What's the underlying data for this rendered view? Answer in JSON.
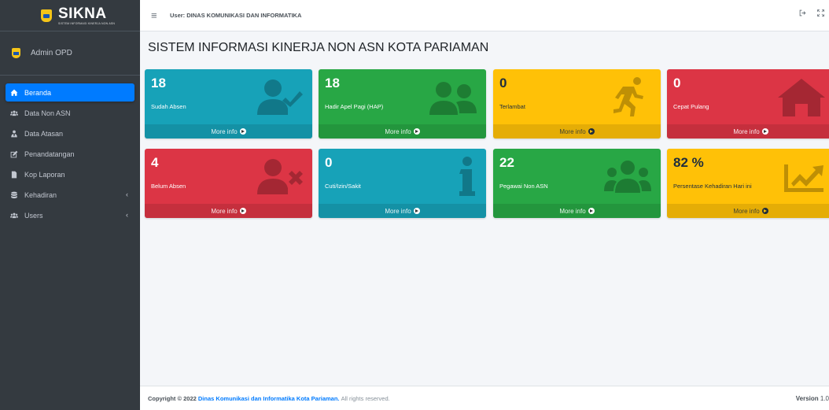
{
  "brand": {
    "name": "SIKNA",
    "subtitle": "SISTEM INFORMASI KINERJA NON ASN"
  },
  "user_panel": {
    "name": "Admin OPD"
  },
  "nav": {
    "items": [
      {
        "label": "Beranda",
        "icon": "home-icon",
        "active": true
      },
      {
        "label": "Data Non ASN",
        "icon": "users-icon"
      },
      {
        "label": "Data Atasan",
        "icon": "user-tie-icon"
      },
      {
        "label": "Penandatangan",
        "icon": "edit-icon"
      },
      {
        "label": "Kop Laporan",
        "icon": "file-icon"
      },
      {
        "label": "Kehadiran",
        "icon": "database-icon",
        "has_children": true
      },
      {
        "label": "Users",
        "icon": "users-icon",
        "has_children": true
      }
    ],
    "chevron": "‹"
  },
  "topbar": {
    "user_info": "User: DINAS KOMUNIKASI DAN INFORMATIKA",
    "hamburger": "≡"
  },
  "page": {
    "title": "SISTEM INFORMASI KINERJA NON ASN KOTA PARIAMAN"
  },
  "boxes": [
    {
      "value": "18",
      "label": "Sudah Absen",
      "color": "#17a2b8",
      "icon": "user-check-icon",
      "link": "More info"
    },
    {
      "value": "18",
      "label": "Hadir Apel Pagi (HAP)",
      "color": "#28a745",
      "icon": "user-friends-icon",
      "link": "More info"
    },
    {
      "value": "0",
      "label": "Terlambat",
      "color": "#ffc107",
      "icon": "running-icon",
      "link": "More info"
    },
    {
      "value": "0",
      "label": "Cepat Pulang",
      "color": "#dc3545",
      "icon": "home-icon",
      "link": "More info"
    },
    {
      "value": "4",
      "label": "Belum Absen",
      "color": "#dc3545",
      "icon": "user-times-icon",
      "link": "More info"
    },
    {
      "value": "0",
      "label": "Cuti/Izin/Sakit",
      "color": "#17a2b8",
      "icon": "info-icon",
      "link": "More info"
    },
    {
      "value": "22",
      "label": "Pegawai Non ASN",
      "color": "#28a745",
      "icon": "users-icon",
      "link": "More info"
    },
    {
      "value": "82 %",
      "label": "Persentase Kehadiran Hari ini",
      "color": "#ffc107",
      "icon": "chart-line-icon",
      "link": "More info"
    }
  ],
  "footer": {
    "prefix": "Copyright © 2022",
    "org": "Dinas Komunikasi dan Informatika Kota Pariaman.",
    "suffix": "All rights reserved.",
    "version_label": "Version",
    "version": "1.0"
  }
}
